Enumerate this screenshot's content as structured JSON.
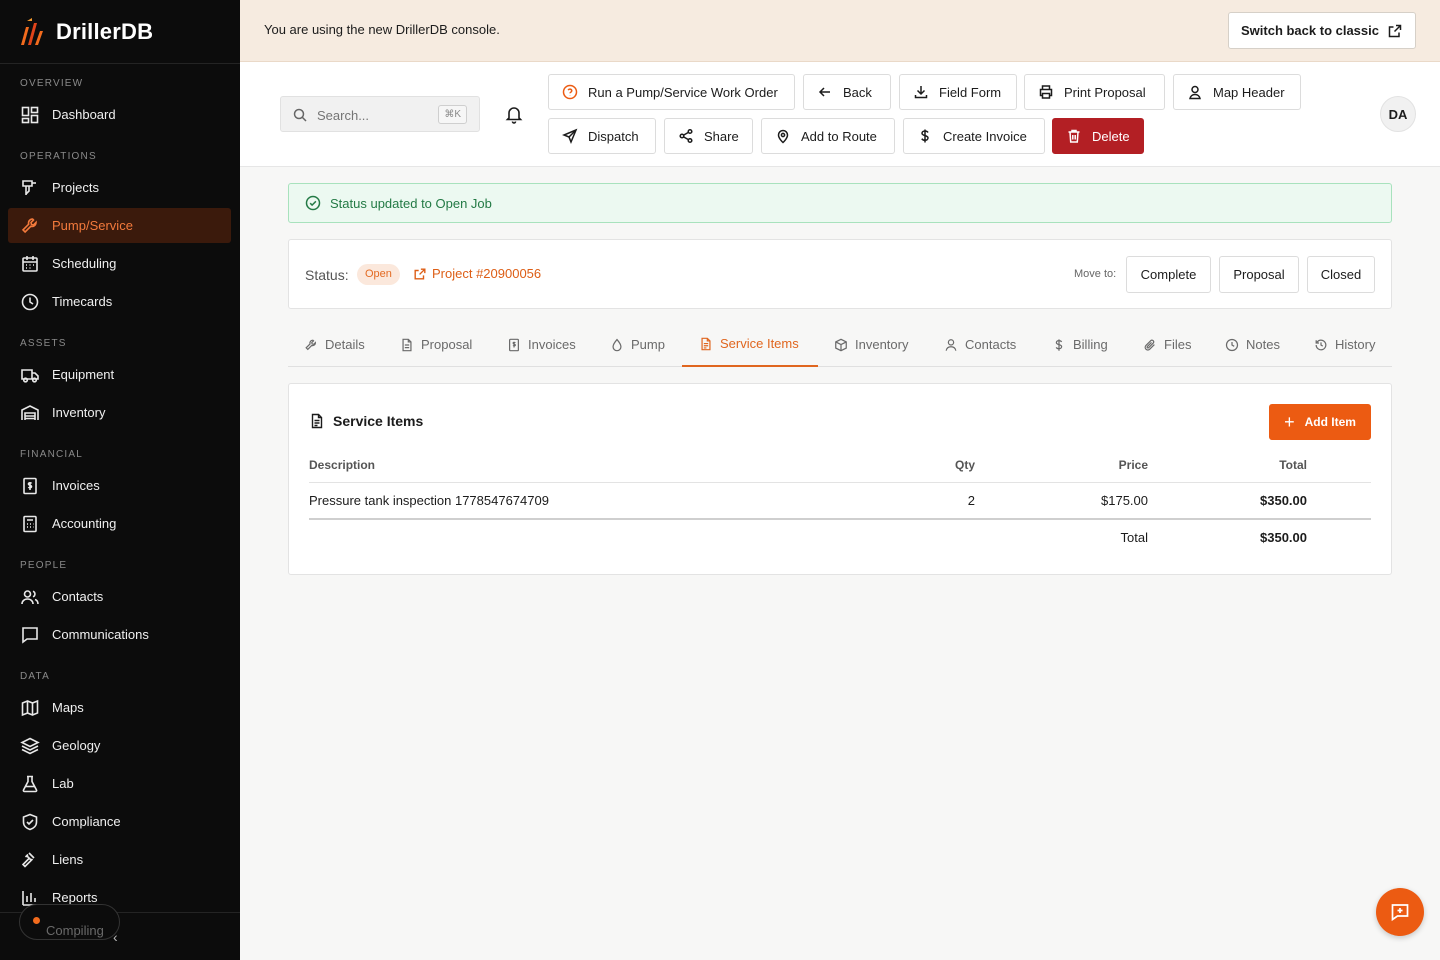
{
  "brand": {
    "name": "DrillerDB"
  },
  "sidebar": {
    "sections": [
      {
        "label": "OVERVIEW",
        "items": [
          {
            "label": "Dashboard",
            "icon": "dashboard-icon"
          }
        ]
      },
      {
        "label": "OPERATIONS",
        "items": [
          {
            "label": "Projects",
            "icon": "drill-icon"
          },
          {
            "label": "Pump/Service",
            "icon": "wrench-icon",
            "active": true
          },
          {
            "label": "Scheduling",
            "icon": "calendar-icon"
          },
          {
            "label": "Timecards",
            "icon": "clock-icon"
          }
        ]
      },
      {
        "label": "ASSETS",
        "items": [
          {
            "label": "Equipment",
            "icon": "truck-icon"
          },
          {
            "label": "Inventory",
            "icon": "warehouse-icon"
          }
        ]
      },
      {
        "label": "FINANCIAL",
        "items": [
          {
            "label": "Invoices",
            "icon": "invoice-icon"
          },
          {
            "label": "Accounting",
            "icon": "calculator-icon"
          }
        ]
      },
      {
        "label": "PEOPLE",
        "items": [
          {
            "label": "Contacts",
            "icon": "users-icon"
          },
          {
            "label": "Communications",
            "icon": "message-icon"
          }
        ]
      },
      {
        "label": "DATA",
        "items": [
          {
            "label": "Maps",
            "icon": "map-icon"
          },
          {
            "label": "Geology",
            "icon": "layers-icon"
          },
          {
            "label": "Lab",
            "icon": "flask-icon"
          },
          {
            "label": "Compliance",
            "icon": "shield-icon"
          },
          {
            "label": "Liens",
            "icon": "gavel-icon"
          },
          {
            "label": "Reports",
            "icon": "bar-chart-icon"
          }
        ]
      }
    ],
    "footer": {
      "status": "Compiling"
    }
  },
  "banner": {
    "text": "You are using the new DrillerDB console.",
    "switch_label": "Switch back to classic"
  },
  "header": {
    "search_placeholder": "Search...",
    "search_shortcut": "⌘K",
    "avatar_initials": "DA",
    "actions": [
      {
        "label": "Run a Pump/Service Work Order",
        "icon": "help-circle-icon"
      },
      {
        "label": "Back",
        "icon": "arrow-left-icon"
      },
      {
        "label": "Field Form",
        "icon": "download-icon"
      },
      {
        "label": "Print Proposal",
        "icon": "printer-icon"
      },
      {
        "label": "Map Header",
        "icon": "user-pin-icon"
      },
      {
        "label": "Dispatch",
        "icon": "send-icon"
      },
      {
        "label": "Share",
        "icon": "share-icon"
      },
      {
        "label": "Add to Route",
        "icon": "map-pin-icon"
      },
      {
        "label": "Create Invoice",
        "icon": "dollar-icon"
      },
      {
        "label": "Delete",
        "icon": "trash-icon",
        "danger": true
      }
    ]
  },
  "alert": {
    "text": "Status updated to Open Job"
  },
  "status": {
    "label": "Status:",
    "value": "Open",
    "project_link": "Project #20900056",
    "move_to_label": "Move to:",
    "move_options": [
      "Complete",
      "Proposal",
      "Closed"
    ]
  },
  "tabs": [
    {
      "label": "Details",
      "icon": "wrench-icon"
    },
    {
      "label": "Proposal",
      "icon": "file-icon"
    },
    {
      "label": "Invoices",
      "icon": "invoice-icon"
    },
    {
      "label": "Pump",
      "icon": "droplet-icon"
    },
    {
      "label": "Service Items",
      "icon": "file-text-icon",
      "active": true
    },
    {
      "label": "Inventory",
      "icon": "box-icon"
    },
    {
      "label": "Contacts",
      "icon": "user-icon"
    },
    {
      "label": "Billing",
      "icon": "dollar-icon"
    },
    {
      "label": "Files",
      "icon": "paperclip-icon"
    },
    {
      "label": "Notes",
      "icon": "clock-icon"
    },
    {
      "label": "History",
      "icon": "history-icon"
    }
  ],
  "service_items": {
    "title": "Service Items",
    "add_label": "Add Item",
    "columns": {
      "description": "Description",
      "qty": "Qty",
      "price": "Price",
      "total": "Total"
    },
    "rows": [
      {
        "description": "Pressure tank inspection 1778547674709",
        "qty": "2",
        "price": "$175.00",
        "total": "$350.00"
      }
    ],
    "footer": {
      "label": "Total",
      "value": "$350.00"
    }
  },
  "colors": {
    "accent": "#ec5b12",
    "danger": "#b31f24",
    "sidebar_bg": "#0c0c0c",
    "success": "#237a45"
  }
}
